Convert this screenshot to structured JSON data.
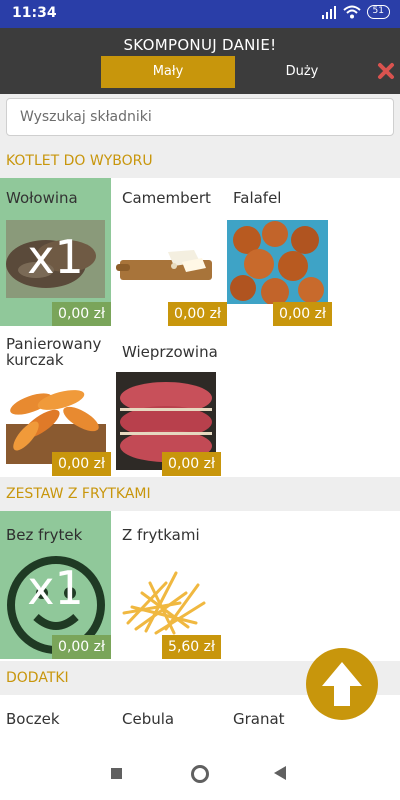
{
  "status": {
    "time": "11:34",
    "battery": "51"
  },
  "header": {
    "title": "SKOMPONUJ DANIE!",
    "size_small": "Mały",
    "size_big": "Duży"
  },
  "search": {
    "placeholder": "Wyszukaj składniki"
  },
  "sections": {
    "kotlet": "KOTLET DO WYBORU",
    "frytki": "ZESTAW Z FRYTKAMI",
    "dodatki": "DODATKI"
  },
  "kotlet_items": [
    {
      "name": "Wołowina",
      "price": "0,00 zł",
      "qty": "x1"
    },
    {
      "name": "Camembert",
      "price": "0,00 zł"
    },
    {
      "name": "Falafel",
      "price": "0,00 zł"
    },
    {
      "name": "Panierowany kurczak",
      "price": "0,00 zł"
    },
    {
      "name": "Wieprzowina",
      "price": "0,00 zł"
    }
  ],
  "frytki_items": [
    {
      "name": "Bez frytek",
      "price": "0,00 zł",
      "qty": "x1"
    },
    {
      "name": "Z frytkami",
      "price": "5,60 zł"
    }
  ],
  "dodatki_items": [
    {
      "name": "Boczek"
    },
    {
      "name": "Cebula"
    },
    {
      "name": "Granat"
    }
  ],
  "icons": {
    "close": "close-icon",
    "scroll_up": "arrow-up-icon",
    "nav_recent": "square-icon",
    "nav_home": "circle-icon",
    "nav_back": "triangle-back-icon"
  },
  "colors": {
    "accent": "#c8960c",
    "selected": "#90c89a",
    "header": "#3c3c3c",
    "statusbar": "#2a3ea8"
  }
}
